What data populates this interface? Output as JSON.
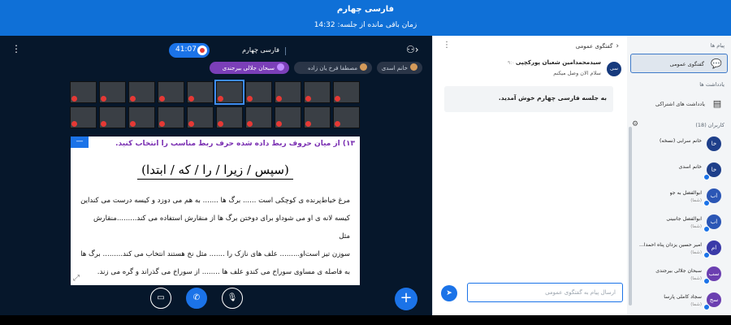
{
  "header": {
    "title": "فارسی چهارم",
    "time_left": "زمان باقی مانده از جلسه: 14:32"
  },
  "presentation": {
    "room_title": "فارسی چهارم",
    "recording_time": "41:07",
    "presenters": [
      "سبحان جلالی بیرجندی",
      "مصطفا فرخ یان زاده",
      "خانم اسدی"
    ],
    "question": "۱۳) از میان حروف ربط داده شده حرف ربط مناسب را انتخاب کنید.",
    "options": "(سپس / زیرا / را / که / ابتدا)",
    "paragraph": [
      "مرغ خیاط‌پرنده ی کوچکی است ...... برگ ها ....... به هم می دوزد و کیسه درست می کند‌این",
      "کیسه لانه ی او می شود‌او برای دوختن برگ ها از منقارش استفاده می کند.........منقارش مثل",
      "سوزن تیز است‌او......... علف های نازک را ....... مثل نخ هستند انتخاب می کند......... برگ ها",
      "به فاصله ی مساوی سوراخ می کند‌و علف ها ........ از سوراخ می گذراند و گره می زند."
    ]
  },
  "chat": {
    "title": "گفتگوی عمومی",
    "message": {
      "avatar": "سی",
      "sender": "سیدمحمدامین شعبان پورکچپی",
      "time": "۹:۰۰",
      "text": "سلام الان وصل میکنم"
    },
    "welcome": "به جلسه فارسی چهارم خوش آمدید.",
    "input_placeholder": "ارسال پیام به گفتگوی عمومی"
  },
  "sidebar": {
    "messages_header": "پیام ها",
    "public_chat": "گفتگوی عمومی",
    "notes_header": "یادداشت ها",
    "shared_notes": "یادداشت های اشتراکی",
    "users_header": "کاربران (18)",
    "users": [
      {
        "initials": "خا",
        "name": "خانم سرابی (نسخه)",
        "status": "",
        "color": "#1e3f8a"
      },
      {
        "initials": "خا",
        "name": "خانم اسدی",
        "status": "",
        "color": "#1e3f8a"
      },
      {
        "initials": "اب",
        "name": "ابوالفضل به جو",
        "status": "(شما)",
        "color": "#2b56b5"
      },
      {
        "initials": "اب",
        "name": "ابوالفضل جانبینی",
        "status": "(شما)",
        "color": "#2b56b5"
      },
      {
        "initials": "ام",
        "name": "امیر حسین یزدان پناه احمدا...",
        "status": "(شما)",
        "color": "#3a3aa8"
      },
      {
        "initials": "سب",
        "name": "سبحان جلالی بیرجندی",
        "status": "(شما)",
        "color": "#6b3fb0"
      },
      {
        "initials": "سج",
        "name": "سجاد کاملی پارسا",
        "status": "(شما)",
        "color": "#6b3fb0"
      }
    ]
  }
}
